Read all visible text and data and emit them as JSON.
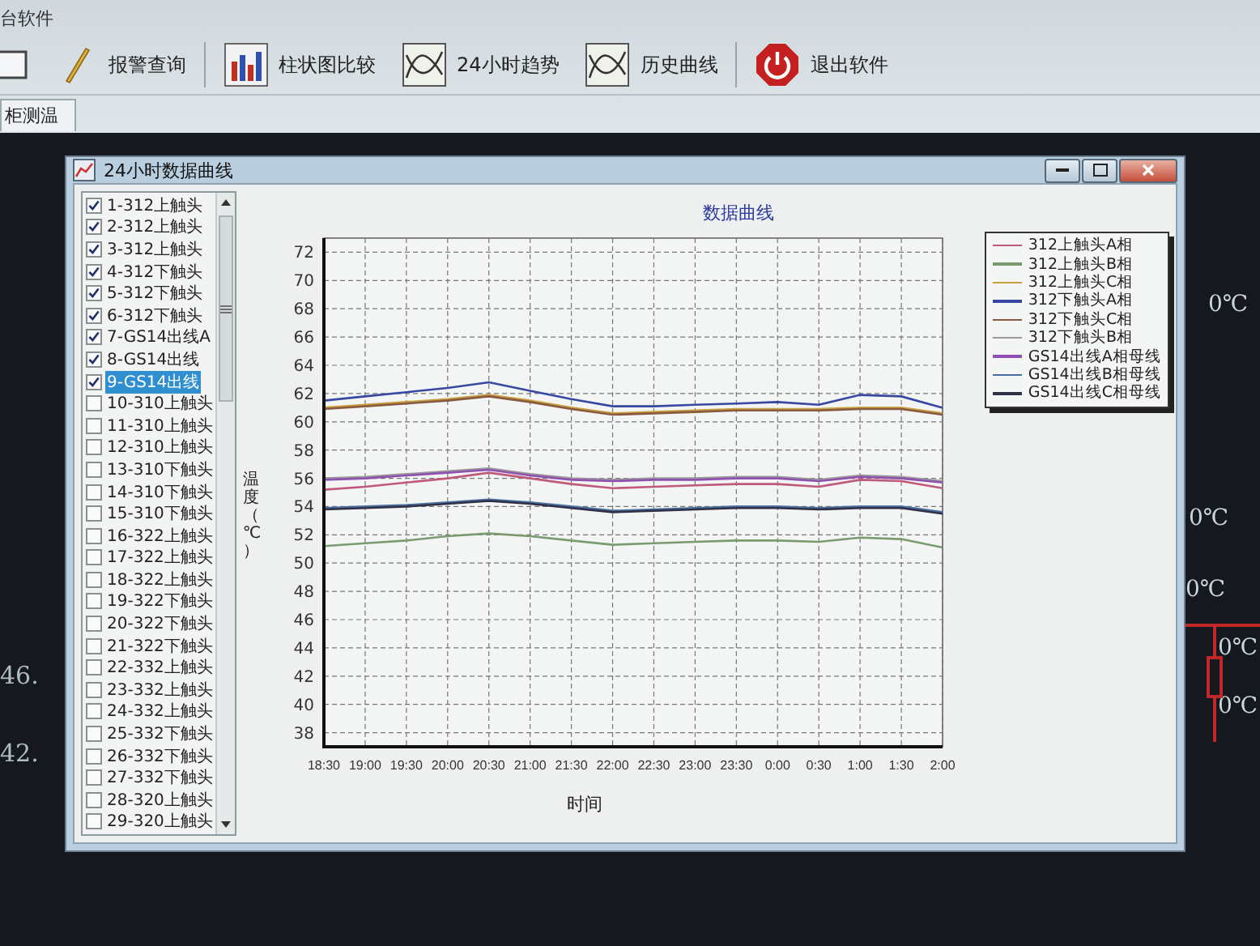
{
  "app_title": "台软件",
  "toolbar": [
    {
      "kind": "window"
    },
    {
      "kind": "pencil",
      "label": "报警查询"
    },
    {
      "kind": "bars",
      "label": "柱状图比较"
    },
    {
      "kind": "trend",
      "label": "24小时趋势"
    },
    {
      "kind": "trend",
      "label": "历史曲线"
    },
    {
      "kind": "power",
      "label": "退出软件"
    }
  ],
  "tabs": [
    {
      "label": "柜测温",
      "selected": true
    }
  ],
  "left_readings": [
    "46.",
    "42."
  ],
  "right_readings": [
    "0℃",
    "0℃",
    "0℃",
    "0℃",
    "0℃"
  ],
  "dialog": {
    "title": "24小时数据曲线",
    "channels": [
      {
        "label": "1-312上触头",
        "checked": true,
        "selected": false
      },
      {
        "label": "2-312上触头",
        "checked": true,
        "selected": false
      },
      {
        "label": "3-312上触头",
        "checked": true,
        "selected": false
      },
      {
        "label": "4-312下触头",
        "checked": true,
        "selected": false
      },
      {
        "label": "5-312下触头",
        "checked": true,
        "selected": false
      },
      {
        "label": "6-312下触头",
        "checked": true,
        "selected": false
      },
      {
        "label": "7-GS14出线A",
        "checked": true,
        "selected": false
      },
      {
        "label": "8-GS14出线",
        "checked": true,
        "selected": false
      },
      {
        "label": "9-GS14出线",
        "checked": true,
        "selected": true
      },
      {
        "label": "10-310上触头",
        "checked": false,
        "selected": false
      },
      {
        "label": "11-310上触头",
        "checked": false,
        "selected": false
      },
      {
        "label": "12-310上触头",
        "checked": false,
        "selected": false
      },
      {
        "label": "13-310下触头",
        "checked": false,
        "selected": false
      },
      {
        "label": "14-310下触头",
        "checked": false,
        "selected": false
      },
      {
        "label": "15-310下触头",
        "checked": false,
        "selected": false
      },
      {
        "label": "16-322上触头",
        "checked": false,
        "selected": false
      },
      {
        "label": "17-322上触头",
        "checked": false,
        "selected": false
      },
      {
        "label": "18-322上触头",
        "checked": false,
        "selected": false
      },
      {
        "label": "19-322下触头",
        "checked": false,
        "selected": false
      },
      {
        "label": "20-322下触头",
        "checked": false,
        "selected": false
      },
      {
        "label": "21-322下触头",
        "checked": false,
        "selected": false
      },
      {
        "label": "22-332上触头",
        "checked": false,
        "selected": false
      },
      {
        "label": "23-332上触头",
        "checked": false,
        "selected": false
      },
      {
        "label": "24-332上触头",
        "checked": false,
        "selected": false
      },
      {
        "label": "25-332下触头",
        "checked": false,
        "selected": false
      },
      {
        "label": "26-332下触头",
        "checked": false,
        "selected": false
      },
      {
        "label": "27-332下触头",
        "checked": false,
        "selected": false
      },
      {
        "label": "28-320上触头",
        "checked": false,
        "selected": false
      },
      {
        "label": "29-320上触头",
        "checked": false,
        "selected": false
      }
    ],
    "chart_data": {
      "type": "line",
      "grid": true,
      "legend": true,
      "title": "数据曲线",
      "xlabel": "时间",
      "ylabel": "温度（℃）",
      "categories": [
        "18:30",
        "19:00",
        "19:30",
        "20:00",
        "20:30",
        "21:00",
        "21:30",
        "22:00",
        "22:30",
        "23:00",
        "23:30",
        "0:00",
        "0:30",
        "1:00",
        "1:30",
        "2:00"
      ],
      "ylim": [
        37,
        73
      ],
      "yticks": [
        38,
        40,
        42,
        44,
        46,
        48,
        50,
        52,
        54,
        56,
        58,
        60,
        62,
        64,
        66,
        68,
        70,
        72
      ],
      "series": [
        {
          "name": "312上触头A相",
          "color": "#c05a7a",
          "values": [
            55.2,
            55.4,
            55.7,
            56.0,
            56.4,
            56.0,
            55.6,
            55.3,
            55.4,
            55.5,
            55.6,
            55.6,
            55.4,
            55.9,
            55.8,
            55.3
          ]
        },
        {
          "name": "312上触头B相",
          "color": "#7a9a70",
          "values": [
            51.2,
            51.4,
            51.6,
            51.9,
            52.1,
            51.9,
            51.6,
            51.3,
            51.4,
            51.5,
            51.6,
            51.6,
            51.5,
            51.8,
            51.7,
            51.1
          ]
        },
        {
          "name": "312上触头C相",
          "color": "#c8a040",
          "values": [
            61.0,
            61.2,
            61.4,
            61.6,
            61.9,
            61.5,
            61.0,
            60.6,
            60.7,
            60.8,
            60.9,
            60.9,
            60.9,
            61.0,
            61.0,
            60.6
          ]
        },
        {
          "name": "312下触头A相",
          "color": "#3848a0",
          "values": [
            61.5,
            61.8,
            62.1,
            62.4,
            62.8,
            62.2,
            61.6,
            61.1,
            61.1,
            61.2,
            61.3,
            61.4,
            61.2,
            61.9,
            61.8,
            61.0
          ]
        },
        {
          "name": "312下触头C相",
          "color": "#8a5a40",
          "values": [
            60.9,
            61.1,
            61.3,
            61.5,
            61.8,
            61.4,
            60.9,
            60.5,
            60.6,
            60.7,
            60.8,
            60.8,
            60.8,
            60.9,
            60.9,
            60.5
          ]
        },
        {
          "name": "312下触头B相",
          "color": "#9a9a9a",
          "values": [
            56.0,
            56.1,
            56.3,
            56.5,
            56.7,
            56.3,
            56.0,
            55.9,
            56.0,
            56.0,
            56.1,
            56.1,
            55.9,
            56.2,
            56.1,
            55.8
          ]
        },
        {
          "name": "GS14出线A相母线",
          "color": "#9050b0",
          "values": [
            55.9,
            56.0,
            56.2,
            56.4,
            56.6,
            56.2,
            55.9,
            55.8,
            55.9,
            55.9,
            56.0,
            56.0,
            55.8,
            56.1,
            56.0,
            55.7
          ]
        },
        {
          "name": "GS14出线B相母线",
          "color": "#4a70a0",
          "values": [
            53.9,
            54.0,
            54.1,
            54.3,
            54.5,
            54.3,
            54.0,
            53.7,
            53.8,
            53.9,
            54.0,
            54.0,
            53.9,
            54.0,
            54.0,
            53.6
          ]
        },
        {
          "name": "GS14出线C相母线",
          "color": "#303048",
          "values": [
            53.8,
            53.9,
            54.0,
            54.2,
            54.4,
            54.2,
            53.9,
            53.6,
            53.7,
            53.8,
            53.9,
            53.9,
            53.8,
            53.9,
            53.9,
            53.5
          ]
        }
      ]
    }
  }
}
